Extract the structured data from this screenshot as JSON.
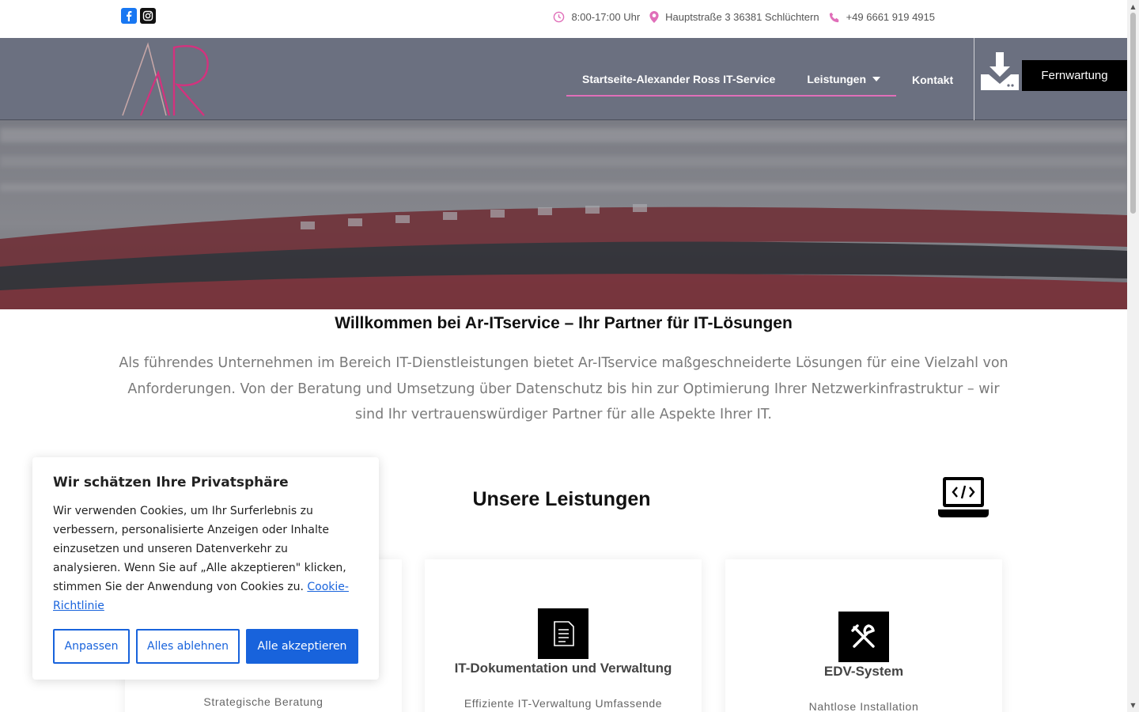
{
  "topbar": {
    "hours": "8:00-17:00 Uhr",
    "address": "Hauptstraße 3 36381 Schlüchtern",
    "phone": "+49 6661 919 4915"
  },
  "nav": {
    "items": [
      {
        "label": "Startseite-Alexander Ross IT-Service"
      },
      {
        "label": "Leistungen"
      },
      {
        "label": "Kontakt"
      }
    ],
    "fernwartung": "Fernwartung"
  },
  "intro": {
    "title": "Willkommen bei Ar-ITservice – Ihr Partner für IT-Lösungen",
    "text": "Als führendes Unternehmen im Bereich IT-Dienstleistungen bietet Ar-ITservice maßgeschneiderte Lösungen für eine Vielzahl von Anforderungen. Von der Beratung und Umsetzung über Datenschutz bis hin zur Optimierung Ihrer Netzwerkinfrastruktur – wir sind Ihr vertrauenswürdiger Partner für alle Aspekte Ihrer IT."
  },
  "services": {
    "title": "Unsere Leistungen",
    "cards": [
      {
        "title": "",
        "subtitle": "Strategische Beratung",
        "icon": "consulting-icon"
      },
      {
        "title": "IT-Dokumentation und Verwaltung",
        "subtitle": "Effiziente IT-Verwaltung Umfassende",
        "icon": "document-icon"
      },
      {
        "title": "EDV-System",
        "subtitle": "Nahtlose Installation",
        "icon": "tools-icon"
      }
    ]
  },
  "cookie": {
    "title": "Wir schätzen Ihre Privatsphäre",
    "text": "Wir verwenden Cookies, um Ihr Surferlebnis zu verbessern, personalisierte Anzeigen oder Inhalte einzusetzen und unseren Datenverkehr zu analysieren. Wenn Sie auf „Alle akzeptieren\" klicken, stimmen Sie der Anwendung von Cookies zu.",
    "link": "Cookie-Richtlinie",
    "btn_customize": "Anpassen",
    "btn_reject": "Alles ablehnen",
    "btn_accept": "Alle akzeptieren"
  },
  "colors": {
    "accent_pink": "#e06fb9",
    "header_bg": "#6b7080",
    "cookie_blue": "#1863dc"
  }
}
